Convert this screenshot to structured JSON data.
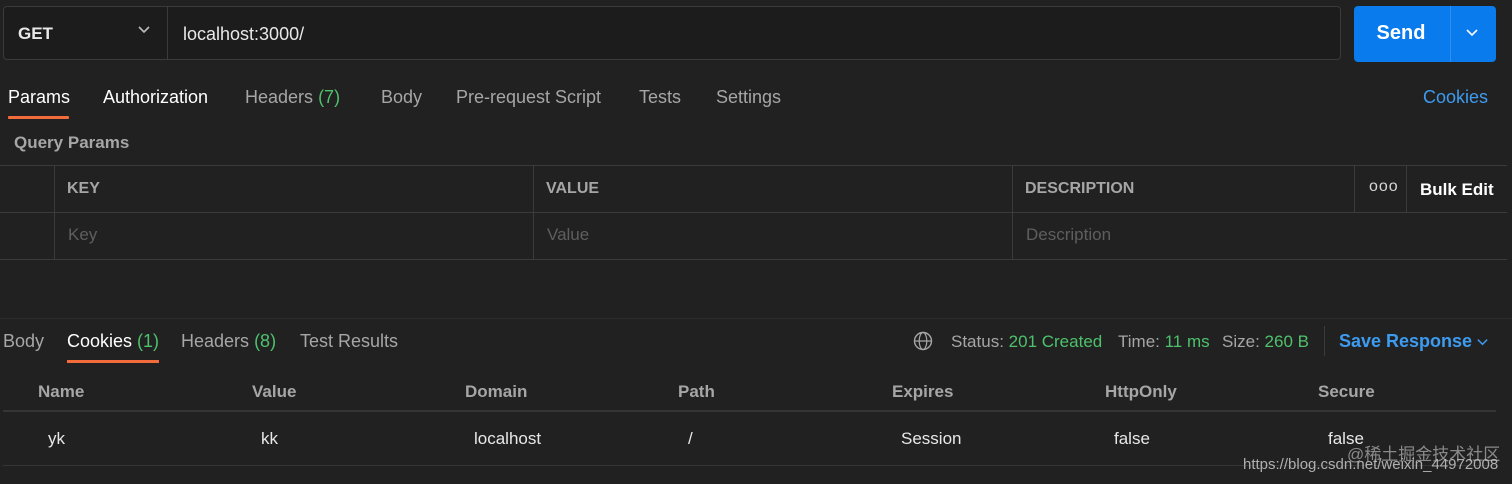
{
  "request": {
    "method": "GET",
    "url": "localhost:3000/",
    "send_label": "Send"
  },
  "request_tabs": {
    "params": "Params",
    "authorization": "Authorization",
    "headers": "Headers",
    "headers_count": "(7)",
    "body": "Body",
    "prerequest": "Pre-request Script",
    "tests": "Tests",
    "settings": "Settings",
    "cookies_link": "Cookies"
  },
  "query_params": {
    "title": "Query Params",
    "columns": [
      "KEY",
      "VALUE",
      "DESCRIPTION"
    ],
    "bulk_edit": "Bulk Edit",
    "more": "ooo",
    "placeholders": {
      "key": "Key",
      "value": "Value",
      "description": "Description"
    }
  },
  "response_tabs": {
    "body": "Body",
    "cookies": "Cookies",
    "cookies_count": "(1)",
    "headers": "Headers",
    "headers_count": "(8)",
    "test_results": "Test Results"
  },
  "response_status": {
    "status_label": "Status:",
    "status_value": "201 Created",
    "time_label": "Time:",
    "time_value": "11 ms",
    "size_label": "Size:",
    "size_value": "260 B",
    "save_response": "Save Response"
  },
  "cookies_table": {
    "columns": [
      "Name",
      "Value",
      "Domain",
      "Path",
      "Expires",
      "HttpOnly",
      "Secure"
    ],
    "rows": [
      [
        "yk",
        "kk",
        "localhost",
        "/",
        "Session",
        "false",
        "false"
      ]
    ]
  },
  "watermark": {
    "line1": "@稀土掘金技术社区",
    "line2": "https://blog.csdn.net/weixin_44972008"
  },
  "colors": {
    "accent_blue": "#097bed",
    "link_blue": "#3d9bf0",
    "tab_underline": "#f26b3a",
    "success_green": "#4ec16c"
  }
}
